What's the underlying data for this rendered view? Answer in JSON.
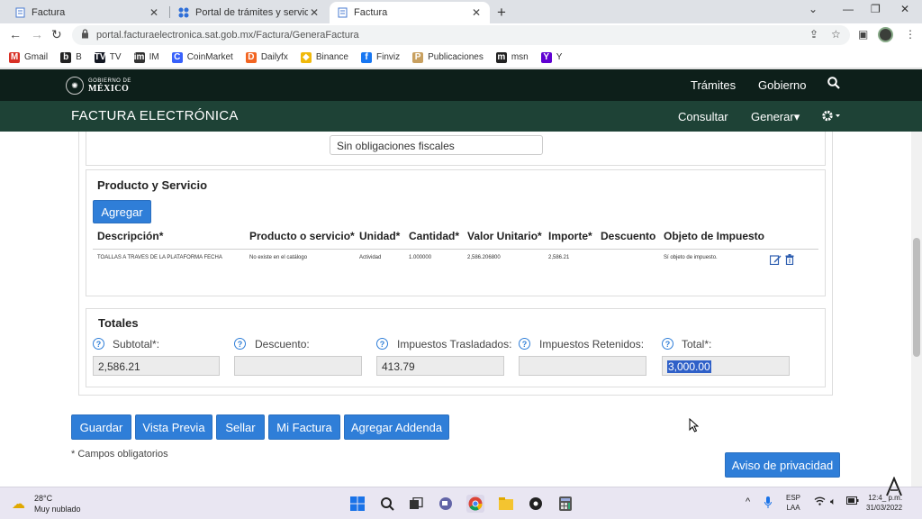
{
  "browser": {
    "tabs": [
      {
        "title": "Factura",
        "active": false
      },
      {
        "title": "Portal de trámites y servicios - SA",
        "active": false
      },
      {
        "title": "Factura",
        "active": true
      }
    ],
    "new_tab": "+",
    "url": "portal.facturaelectronica.sat.gob.mx/Factura/GeneraFactura",
    "bookmarks": [
      {
        "label": "Gmail",
        "icon": "M",
        "color": "#d93025"
      },
      {
        "label": "B",
        "icon": "b",
        "color": "#222222"
      },
      {
        "label": "TV",
        "icon": "TV",
        "color": "#131722"
      },
      {
        "label": "IM",
        "icon": "im",
        "color": "#333333"
      },
      {
        "label": "CoinMarket",
        "icon": "C",
        "color": "#3861fb"
      },
      {
        "label": "Dailyfx",
        "icon": "D",
        "color": "#f26522"
      },
      {
        "label": "Binance",
        "icon": "◆",
        "color": "#f0b90b"
      },
      {
        "label": "Finviz",
        "icon": "f",
        "color": "#1877f2"
      },
      {
        "label": "Publicaciones",
        "icon": "P",
        "color": "#c8a060"
      },
      {
        "label": "msn",
        "icon": "m",
        "color": "#222222"
      },
      {
        "label": "Y",
        "icon": "Y",
        "color": "#6001d2"
      }
    ]
  },
  "gob_header": {
    "logo_line1": "GOBIERNO DE",
    "logo_line2": "MÉXICO",
    "nav": [
      "Trámites",
      "Gobierno"
    ]
  },
  "sub_header": {
    "title": "FACTURA ELECTRÓNICA",
    "consultar": "Consultar",
    "generar": "Generar▾"
  },
  "form": {
    "regimen_value": "Sin obligaciones fiscales",
    "producto_title": "Producto y Servicio",
    "agregar_label": "Agregar",
    "columns": [
      "Descripción*",
      "Producto o servicio*",
      "Unidad*",
      "Cantidad*",
      "Valor Unitario*",
      "Importe*",
      "Descuento",
      "Objeto de Impuesto"
    ],
    "rows": [
      {
        "descripcion": "TOALLAS A TRAVES DE LA PLATAFORMA FECHA",
        "producto": "No existe en el catálogo",
        "unidad": "Actividad",
        "cantidad": "1.000000",
        "valor_unitario": "2,586.206800",
        "importe": "2,586.21",
        "descuento": "",
        "objeto": "Sí objeto de impuesto."
      }
    ],
    "totales_title": "Totales",
    "totales": [
      {
        "label": "Subtotal*:",
        "value": "2,586.21"
      },
      {
        "label": "Descuento:",
        "value": ""
      },
      {
        "label": "Impuestos Trasladados:",
        "value": "413.79"
      },
      {
        "label": "Impuestos Retenidos:",
        "value": ""
      },
      {
        "label": "Total*:",
        "value": "3,000.00"
      }
    ],
    "help_glyph": "?"
  },
  "actions": {
    "guardar": "Guardar",
    "vista_previa": "Vista Previa",
    "sellar": "Sellar",
    "mi_factura": "Mi Factura",
    "agregar_addenda": "Agregar Addenda",
    "aviso": "Aviso de privacidad",
    "required_note": "* Campos obligatorios"
  },
  "taskbar": {
    "temp": "28°C",
    "weather": "Muy nublado",
    "lang_1": "ESP",
    "lang_2": "LAA",
    "time": "12:4_ p.m.",
    "date": "31/03/2022"
  }
}
